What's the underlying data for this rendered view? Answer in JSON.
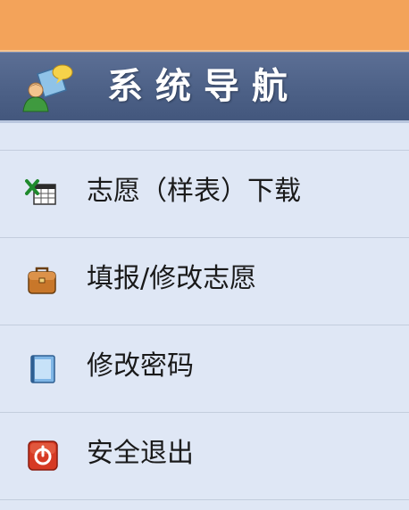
{
  "nav": {
    "title": "系统导航",
    "header_icon": "user-chat-icon",
    "items": [
      {
        "label": "志愿（样表）下载",
        "icon": "excel-download-icon"
      },
      {
        "label": "填报/修改志愿",
        "icon": "briefcase-icon"
      },
      {
        "label": "修改密码",
        "icon": "notepad-icon"
      },
      {
        "label": "安全退出",
        "icon": "power-icon"
      }
    ]
  },
  "colors": {
    "top_bar": "#f3a35a",
    "header_bg": "#4d6187",
    "panel_bg": "#dfe7f5",
    "text": "#1a1a1a"
  }
}
